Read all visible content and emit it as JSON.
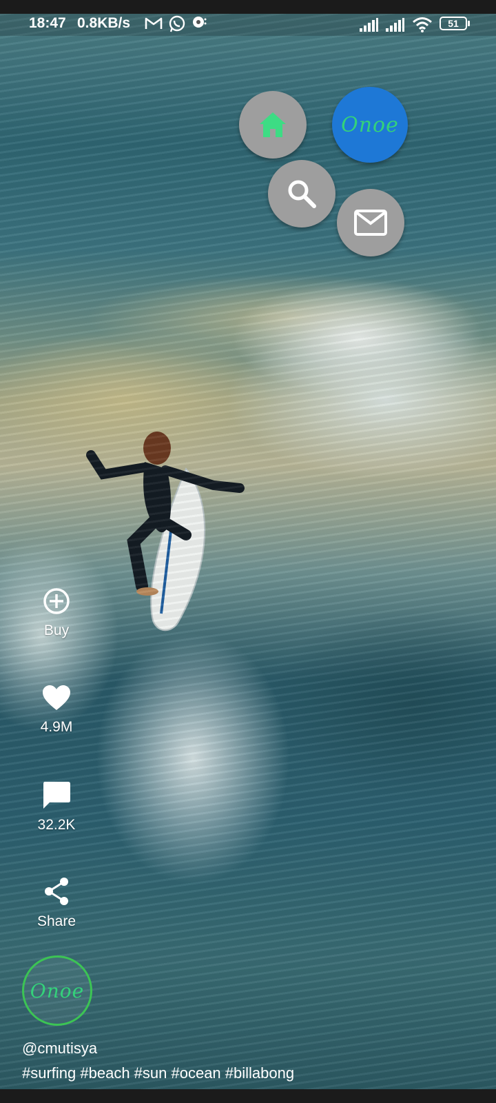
{
  "status_bar": {
    "time": "18:47",
    "net_speed": "0.8KB/s",
    "battery": "51",
    "notification_icons": [
      "gmail-icon",
      "whatsapp-icon",
      "chat-icon"
    ]
  },
  "fab_menu": {
    "brand_logo": "Onoe",
    "items": [
      {
        "name": "home",
        "icon": "home-icon",
        "color": "#3ddc84"
      },
      {
        "name": "search",
        "icon": "search-icon"
      },
      {
        "name": "messages",
        "icon": "mail-icon"
      }
    ],
    "main_color": "#1e78d6"
  },
  "actions": {
    "buy_label": "Buy",
    "likes_count": "4.9M",
    "comments_count": "32.2K",
    "share_label": "Share"
  },
  "profile": {
    "avatar_logo": "Onoe",
    "ring_color": "#3cc454"
  },
  "post": {
    "username": "@cmutisya",
    "hashtags": "#surfing #beach #sun #ocean #billabong"
  }
}
